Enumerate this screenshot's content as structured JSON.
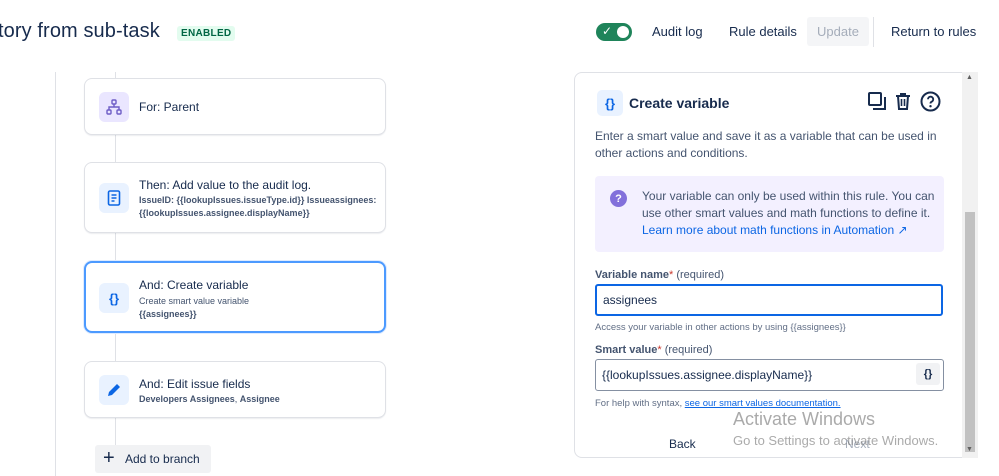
{
  "header": {
    "title": "tory from sub-task",
    "status_badge": "ENABLED",
    "toggle_on": true,
    "audit_log": "Audit log",
    "rule_details": "Rule details",
    "update": "Update",
    "return_to_rules": "Return to rules"
  },
  "flow": {
    "cards": [
      {
        "title": "For: Parent",
        "icon": "branch-icon"
      },
      {
        "title": "Then: Add value to the audit log.",
        "detail": "IssueID: {{lookupIssues.issueType.id}} Issueassignees: {{lookupIssues.assignee.displayName}}",
        "icon": "document-icon"
      },
      {
        "title": "And: Create variable",
        "subtitle": "Create smart value variable",
        "detail": "{{assignees}}",
        "icon": "braces-icon"
      },
      {
        "title": "And: Edit issue fields",
        "detail_main": "Developers Assignees",
        "detail_sep": ", ",
        "detail_end": "Assignee",
        "icon": "pencil-icon"
      }
    ],
    "add_branch": "Add to branch"
  },
  "panel": {
    "icon": "{}",
    "title": "Create variable",
    "description": "Enter a smart value and save it as a variable that can be used in other actions and conditions.",
    "info_text": "Your variable can only be used within this rule. You can use other smart values and math functions to define it.",
    "info_link": "Learn more about math functions in Automation ↗",
    "variable_name": {
      "label": "Variable name",
      "required_mark": "*",
      "required_text": "(required)",
      "value": "assignees",
      "help": "Access your variable in other actions by using {{assignees}}"
    },
    "smart_value": {
      "label": "Smart value",
      "required_mark": "*",
      "required_text": "(required)",
      "value": "{{lookupIssues.assignee.displayName}}",
      "braces_button": "{}",
      "help_prefix": "For help with syntax,",
      "help_link": "see our smart values documentation."
    },
    "back": "Back",
    "next": "Next"
  },
  "watermark": {
    "line1": "Activate Windows",
    "line2": "Go to Settings to activate Windows."
  },
  "colors": {
    "accent": "#0c66e4",
    "toggle": "#1f845a",
    "badge_bg": "#e3fcef",
    "badge_text": "#006644",
    "info_bg": "#f3f0ff",
    "info_icon": "#8270db"
  }
}
